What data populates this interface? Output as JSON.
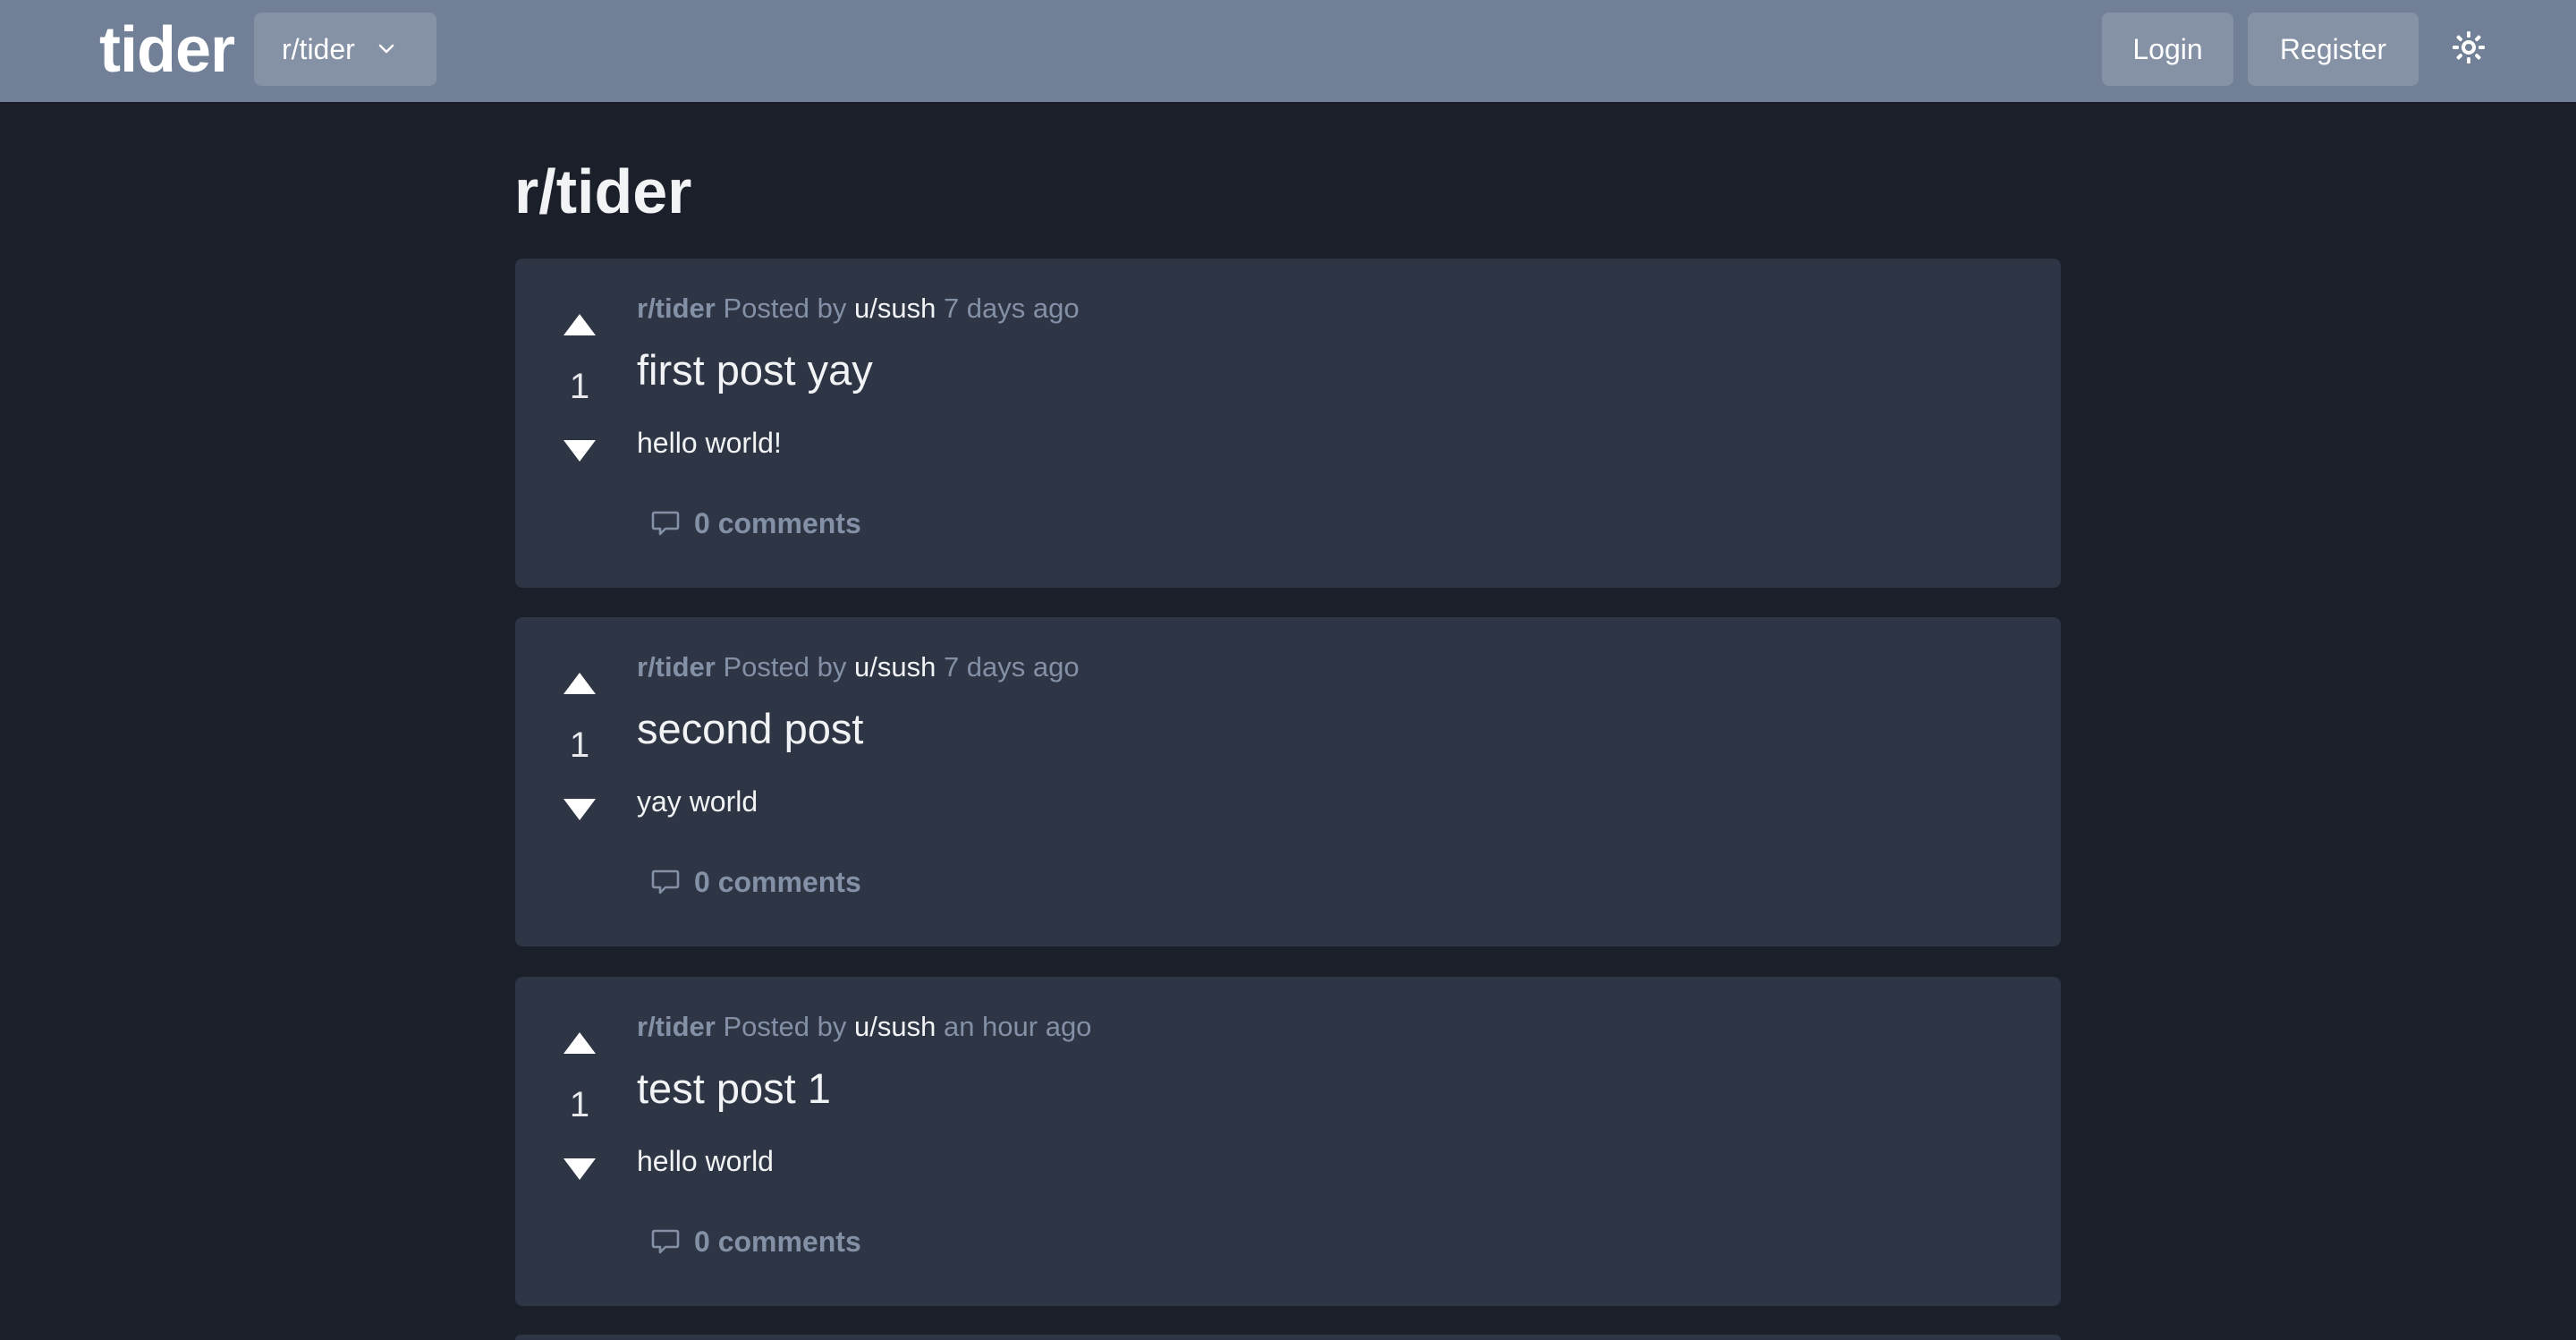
{
  "header": {
    "brand": "tider",
    "community_selector": {
      "label": "r/tider"
    },
    "login_label": "Login",
    "register_label": "Register",
    "theme_toggle_icon": "sun-icon"
  },
  "main": {
    "title": "r/tider",
    "posts": [
      {
        "subreddit": "r/tider",
        "posted_by_text": "Posted by",
        "author": "u/sush",
        "time": "7 days ago",
        "title": "first post yay",
        "body": "hello world!",
        "votes": "1",
        "comments": "0 comments"
      },
      {
        "subreddit": "r/tider",
        "posted_by_text": "Posted by",
        "author": "u/sush",
        "time": "7 days ago",
        "title": "second post",
        "body": "yay world",
        "votes": "1",
        "comments": "0 comments"
      },
      {
        "subreddit": "r/tider",
        "posted_by_text": "Posted by",
        "author": "u/sush",
        "time": "an hour ago",
        "title": "test post 1",
        "body": "hello world",
        "votes": "1",
        "comments": "0 comments"
      }
    ]
  },
  "colors": {
    "background": "#1b1f2a",
    "navbar": "#718096",
    "card": "#2e3545",
    "muted_text": "#8390a6",
    "text": "#f2f3f5"
  }
}
